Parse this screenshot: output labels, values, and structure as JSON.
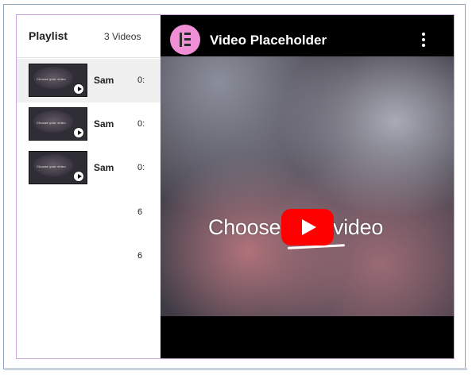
{
  "playlist": {
    "title": "Playlist",
    "count": "3 Videos",
    "items": [
      {
        "name": "Sam",
        "duration": "0:",
        "thumb_text": "Choose your video",
        "active": true
      },
      {
        "name": "Sam",
        "duration": "0:",
        "thumb_text": "Choose your video",
        "active": false
      },
      {
        "name": "Sam",
        "duration": "0:",
        "thumb_text": "Choose your video",
        "active": false
      }
    ],
    "stray": [
      "6",
      "6"
    ]
  },
  "player": {
    "title": "Video Placeholder",
    "overlay_text": "Choose your video",
    "logo_icon": "elementor-logo-icon",
    "menu_icon": "more-vertical-icon",
    "play_icon": "youtube-play-icon"
  },
  "colors": {
    "accent_pink": "#f08fd6",
    "youtube_red": "#ff0000",
    "widget_border": "#c9a6d6"
  }
}
